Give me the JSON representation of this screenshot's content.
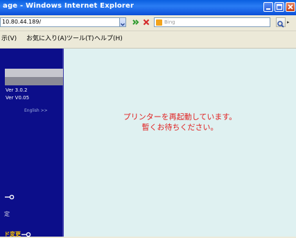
{
  "window": {
    "title": "age - Windows Internet Explorer"
  },
  "addressbar": {
    "url": "10.80.44.189/",
    "search_placeholder": "Bing"
  },
  "menubar": {
    "items": [
      "示(V)",
      "お気に入り(A)",
      "ツール(T)",
      "ヘルプ(H)"
    ]
  },
  "sidebar": {
    "version_1": "Ver 3.0.2",
    "version_2": "Ver V0.05",
    "english_link": "English >>",
    "kanji_item": "定",
    "highlight_item": "ド変更"
  },
  "main": {
    "message_line1": "プリンターを再起動しています。",
    "message_line2": "暫くお待ちください。"
  },
  "colors": {
    "sidebar_bg": "#0c0e8a",
    "main_bg": "#dff1f1",
    "message": "#e02020",
    "highlight": "#f5c000"
  }
}
